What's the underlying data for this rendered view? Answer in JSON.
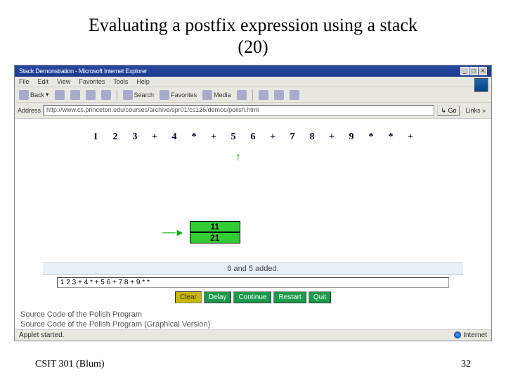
{
  "slide": {
    "title_line1": "Evaluating a postfix expression using a stack",
    "title_line2": "(20)",
    "footer_left": "CSIT 301 (Blum)",
    "footer_right": "32"
  },
  "browser": {
    "window_title": "Stack Demonstration - Microsoft Internet Explorer",
    "menu": [
      "File",
      "Edit",
      "View",
      "Favorites",
      "Tools",
      "Help"
    ],
    "toolbar": {
      "back": "Back",
      "search": "Search",
      "favorites": "Favorites",
      "media": "Media"
    },
    "address_label": "Address",
    "address_value": "http://www.cs.princeton.edu/courses/archive/spr01/cs126/demos/polish.html",
    "go": "Go",
    "links": "Links »",
    "status_left": "Applet started.",
    "status_right": "Internet"
  },
  "applet": {
    "tokens": [
      "1",
      "2",
      "3",
      "+",
      "4",
      "*",
      "+",
      "5",
      "6",
      "+",
      "7",
      "8",
      "+",
      "9",
      "*",
      "*",
      "+"
    ],
    "pointer_index": 8,
    "stack": [
      "11",
      "21"
    ],
    "status_message": "6 and 5 added.",
    "expression_input": "1 2 3 + 4 * + 5 6 + 7 8 + 9 * *",
    "buttons": {
      "clear": "Clear",
      "delay": "Delay",
      "continue": "Continue",
      "restart": "Restart",
      "quit": "Quit"
    },
    "source_links": {
      "l1": "Source Code of the Polish Program",
      "l2": "Source Code of the Polish Program (Graphical Version)"
    }
  }
}
